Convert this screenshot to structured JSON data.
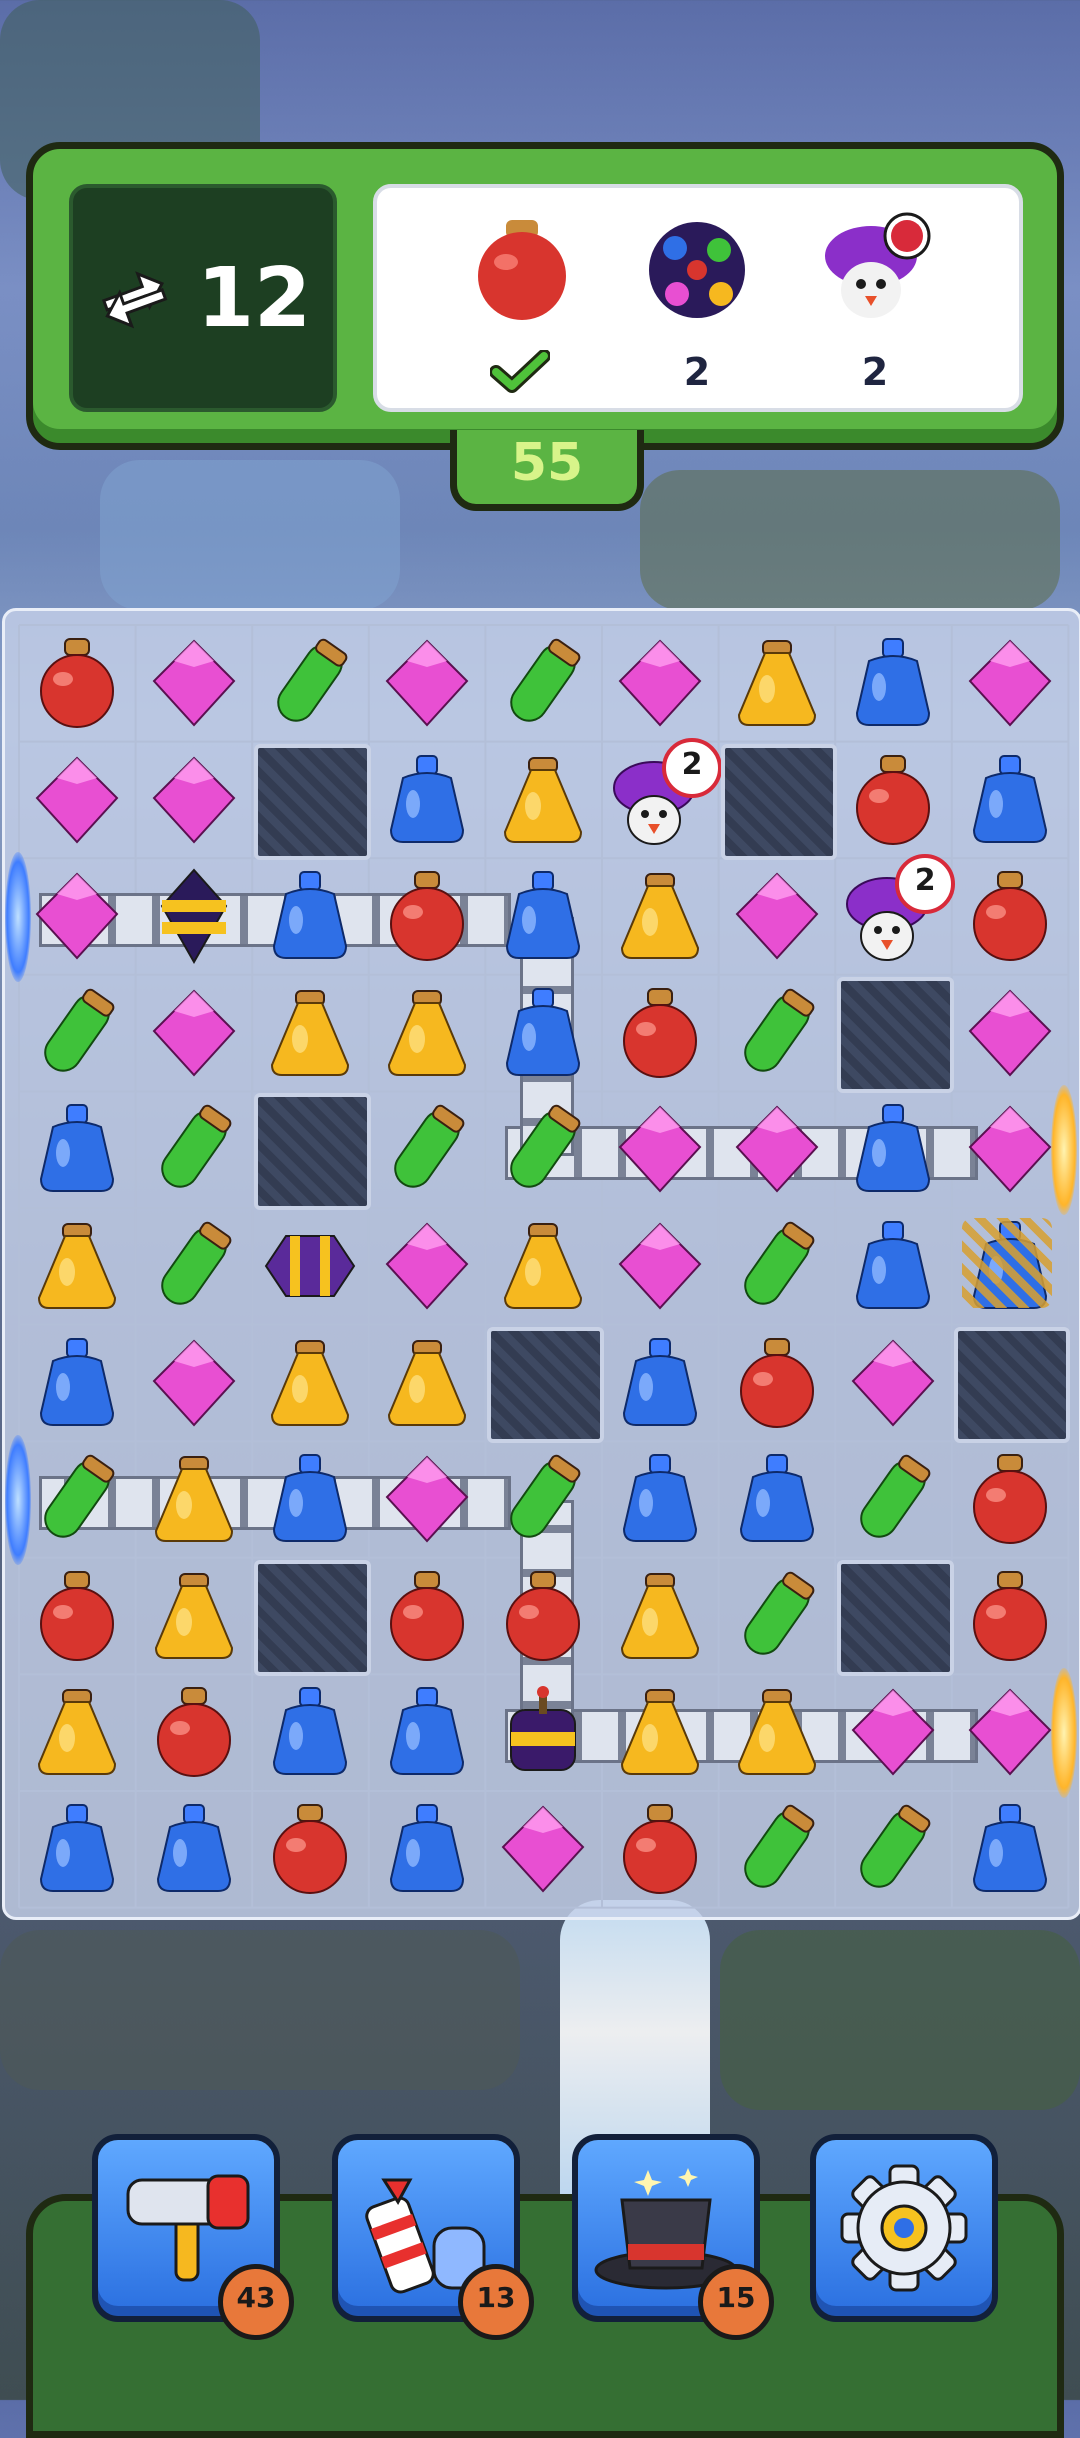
{
  "hud": {
    "moves": "12",
    "score": "55",
    "goals": [
      {
        "name": "red-potion-goal-icon",
        "count": "",
        "done": true
      },
      {
        "name": "bomb-ball-goal-icon",
        "count": "2",
        "done": false
      },
      {
        "name": "penguin-goal-icon",
        "count": "2",
        "done": false
      }
    ]
  },
  "colors": {
    "red": "#d8352e",
    "pink": "#e84fd2",
    "green": "#3fc23a",
    "yellow": "#f6b81f",
    "blue": "#2f6fe6",
    "hud_green": "#5bb443",
    "board": "#c4d0e8"
  },
  "board": {
    "rows": [
      [
        "R",
        "P",
        "G",
        "P",
        "G",
        "P",
        "Y",
        "B",
        "P"
      ],
      [
        "P",
        "P",
        "X",
        "B",
        "Y",
        "N",
        "X",
        "R",
        "B"
      ],
      [
        "P",
        "S",
        "B",
        "R",
        "B",
        "Y",
        "P",
        "N",
        "R"
      ],
      [
        "G",
        "P",
        "Y",
        "Y",
        "B",
        "R",
        "G",
        "X",
        "P"
      ],
      [
        "B",
        "G",
        "X",
        "G",
        "G",
        "P",
        "P",
        "B",
        "P"
      ],
      [
        "Y",
        "G",
        "H",
        "P",
        "Y",
        "P",
        "G",
        "B",
        "B"
      ],
      [
        "B",
        "P",
        "Y",
        "Y",
        "X",
        "B",
        "R",
        "P",
        "X"
      ],
      [
        "G",
        "Y",
        "B",
        "P",
        "G",
        "B",
        "B",
        "G",
        "R"
      ],
      [
        "R",
        "Y",
        "X",
        "R",
        "R",
        "Y",
        "G",
        "X",
        "R"
      ],
      [
        "Y",
        "R",
        "B",
        "B",
        "C",
        "Y",
        "Y",
        "P",
        "P"
      ],
      [
        "B",
        "B",
        "R",
        "B",
        "P",
        "R",
        "G",
        "G",
        "B"
      ]
    ],
    "penguin_counts": [
      "2",
      "2"
    ]
  },
  "boosters": [
    {
      "name": "hammer-booster",
      "icon": "hammer-icon",
      "count": "43"
    },
    {
      "name": "firework-booster",
      "icon": "firework-icon",
      "count": "13"
    },
    {
      "name": "magic-hat-booster",
      "icon": "magic-hat-icon",
      "count": "15"
    },
    {
      "name": "settings-button",
      "icon": "gear-icon",
      "count": ""
    }
  ]
}
